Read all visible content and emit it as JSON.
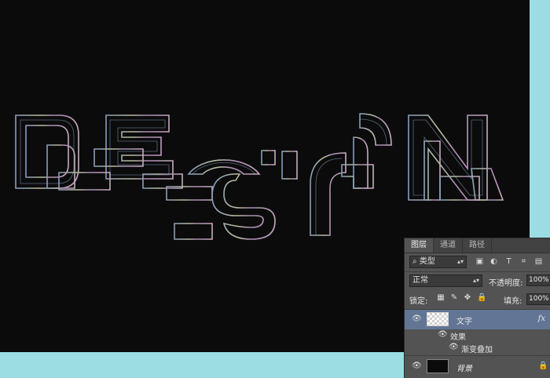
{
  "canvas": {
    "background": "#0b0b0c",
    "artwork_text": "DESIGN",
    "stroke_colors": [
      "#8fa6c6",
      "#c3c9a2",
      "#b692be",
      "#d1b5c7"
    ]
  },
  "layers_panel": {
    "tabs": [
      "图层",
      "通道",
      "路径"
    ],
    "filter_kind": "类型",
    "filter_icons": [
      "image-filter-icon",
      "adjustment-filter-icon",
      "type-filter-icon",
      "shape-filter-icon",
      "smart-object-filter-icon"
    ],
    "blend_mode": "正常",
    "opacity_label": "不透明度:",
    "opacity_value": "100%",
    "lock_label": "锁定:",
    "fill_label": "填充:",
    "fill_value": "100%",
    "layers": [
      {
        "name": "文字",
        "fx": "fx",
        "selected": true
      },
      {
        "name": "效果"
      },
      {
        "name": "渐变叠加"
      },
      {
        "name": "背景",
        "locked": true
      }
    ],
    "selected_color": "#627594"
  },
  "page": {
    "background": "#9bdde2"
  }
}
